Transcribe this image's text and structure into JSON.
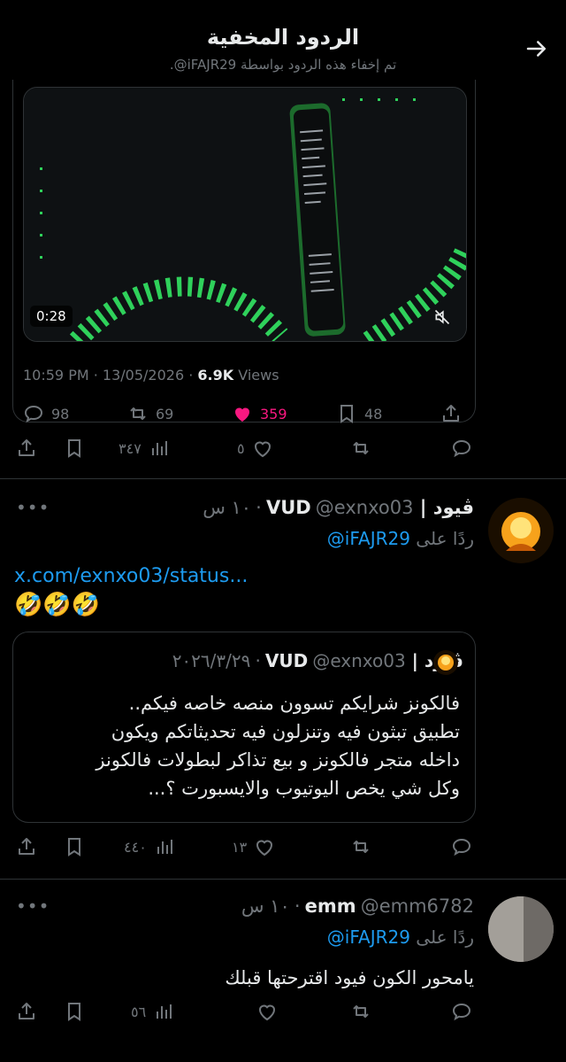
{
  "header": {
    "title": "الردود المخفية",
    "subtitle": "تم إخفاء هذه الردود بواسطة iFAJR29@."
  },
  "quoted_tweet": {
    "video_duration": "0:28",
    "time": "10:59 PM · 13/05/2026 ·",
    "views_count": "6.9K",
    "views_label": "Views",
    "replies": "98",
    "retweets": "69",
    "likes": "359",
    "bookmarks": "48"
  },
  "first_actions": {
    "views": "٣٤٧",
    "likes": "٥"
  },
  "reply1": {
    "name": "ڤيود | VUD",
    "handle": "@exnxo03",
    "time": "١٠ س",
    "replying_prefix": "ردًا على",
    "replying_to": "@iFAJR29",
    "link": "x.com/exnxo03/status...",
    "emojis": "🤣🤣🤣",
    "quote": {
      "name": "ڤيود | VUD",
      "handle": "@exnxo03",
      "date": "٢٠٢٦/٣/٢٩",
      "lines": [
        "فالكونز شرايكم تسوون منصه خاصه فيكم..",
        "تطبيق تبثون فيه وتنزلون فيه تحديثاتكم ويكون",
        "داخله متجر فالكونز و بيع تذاكر لبطولات فالكونز",
        "وكل شي يخص اليوتيوب والايسبورت ؟..."
      ]
    },
    "views": "٤٤٠",
    "likes": "١٣"
  },
  "reply2": {
    "name": "emm",
    "handle": "@emm6782",
    "time": "١٠ س",
    "replying_prefix": "ردًا على",
    "replying_to": "@iFAJR29",
    "text": "يامحور الكون فيود اقترحتها قبلك",
    "views": "٥٦"
  },
  "colors": {
    "background": "#000000",
    "link": "#1d9bf0",
    "like": "#f91880",
    "muted": "#71767b",
    "border": "#2f3336",
    "accent_green": "#2fd15b"
  }
}
